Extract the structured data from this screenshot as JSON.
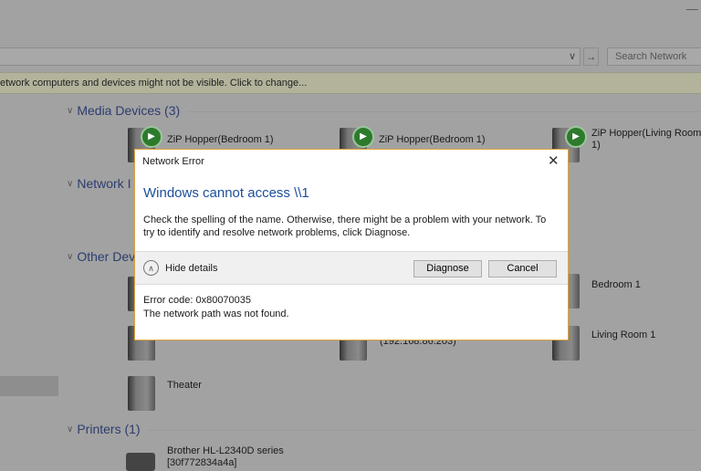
{
  "explorer": {
    "search_placeholder": "Search Network",
    "info_bar": "etwork computers and devices might not be visible. Click to change...",
    "sections": {
      "media": "Media Devices (3)",
      "network": "Network I",
      "other": "Other Dev",
      "printers": "Printers (1)"
    },
    "media_devices": [
      "ZiP Hopper(Bedroom 1)",
      "ZiP Hopper(Bedroom 1)",
      "ZiP Hopper(Living Room 1)"
    ],
    "other_devices": {
      "bedroom": "Bedroom 1",
      "living_room": "Living Room 1",
      "ip": "(192.168.86.203)",
      "theater": "Theater"
    },
    "printer": {
      "name": "Brother HL-L2340D series",
      "id": "[30f772834a4a]"
    }
  },
  "dialog": {
    "title": "Network Error",
    "heading": "Windows cannot access \\\\1",
    "message": "Check the spelling of the name. Otherwise, there might be a problem with your network. To try to identify and resolve network problems, click Diagnose.",
    "hide_details": "Hide details",
    "diagnose": "Diagnose",
    "cancel": "Cancel",
    "error_code": "Error code: 0x80070035",
    "error_text": "The network path was not found."
  },
  "colors": {
    "accent_border": "#e0a23c",
    "heading": "#1c4e9b"
  }
}
